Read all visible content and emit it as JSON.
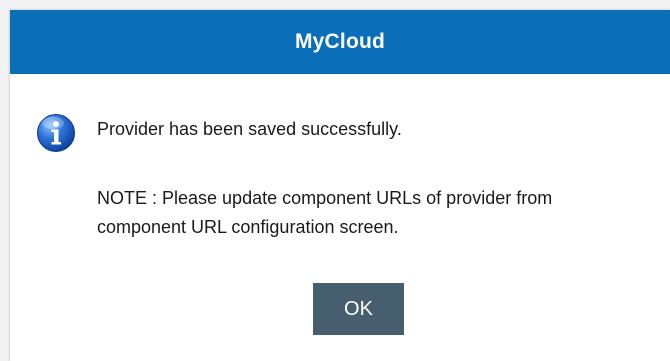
{
  "dialog": {
    "title": "MyCloud",
    "message": "Provider has been saved successfully.",
    "note": "NOTE : Please update component URLs of provider from component URL configuration screen.",
    "ok_label": "OK",
    "icon": "info-icon"
  },
  "colors": {
    "titlebar": "#0a6fb8",
    "button": "#475e6e",
    "text": "#1a1a1a"
  }
}
